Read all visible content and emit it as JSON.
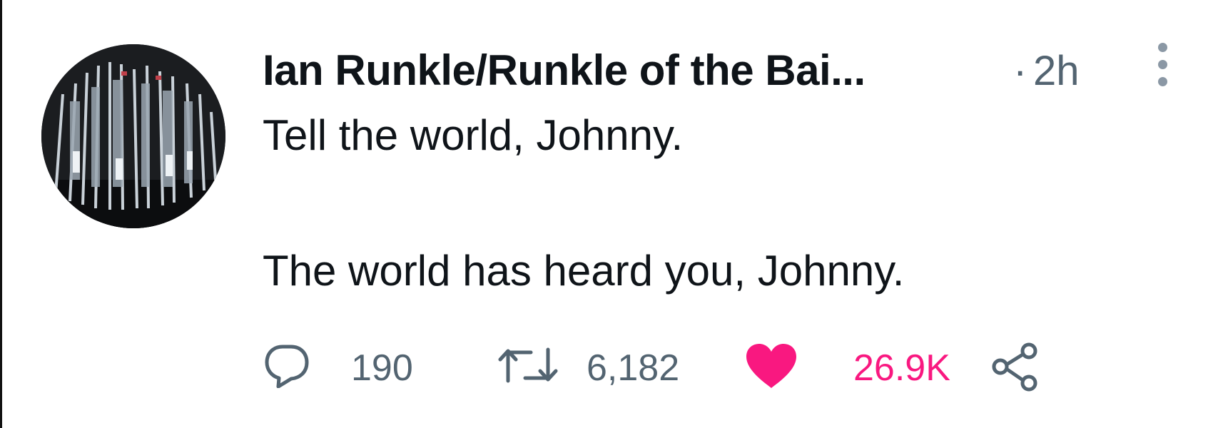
{
  "tweet": {
    "author_name": "Ian Runkle/Runkle of the Bai...",
    "time_separator": "·",
    "timestamp": "2h",
    "text_line_1": "Tell the world, Johnny.",
    "text_line_2": "The world has heard you, Johnny."
  },
  "actions": {
    "replies": "190",
    "retweets": "6,182",
    "likes": "26.9K",
    "liked": true
  },
  "colors": {
    "text_primary": "#0f1419",
    "text_secondary": "#536471",
    "like_active": "#f91880"
  },
  "icons": {
    "reply": "speech-bubble-icon",
    "retweet": "retweet-arrows-icon",
    "like": "heart-filled-icon",
    "share": "share-nodes-icon",
    "more": "vertical-ellipsis-icon"
  }
}
